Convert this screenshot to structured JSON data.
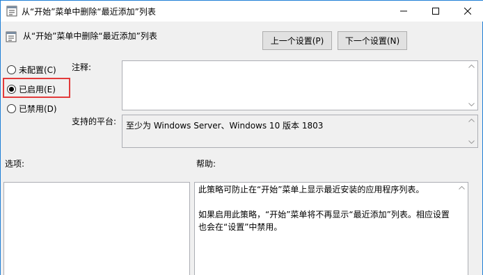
{
  "window": {
    "title": "从“开始”菜单中删除“最近添加”列表"
  },
  "header": {
    "title": "从“开始”菜单中删除“最近添加”列表",
    "prev_button": "上一个设置(P)",
    "next_button": "下一个设置(N)"
  },
  "state": {
    "options": [
      {
        "label": "未配置(C)",
        "checked": false
      },
      {
        "label": "已启用(E)",
        "checked": true
      },
      {
        "label": "已禁用(D)",
        "checked": false
      }
    ]
  },
  "comment": {
    "label": "注释:",
    "value": ""
  },
  "platform": {
    "label": "支持的平台:",
    "value": "至少为 Windows Server、Windows 10 版本 1803"
  },
  "options_section": {
    "label": "选项:"
  },
  "help_section": {
    "label": "帮助:",
    "paragraphs": [
      "此策略可防止在“开始”菜单上显示最近安装的应用程序列表。",
      "如果启用此策略，“开始”菜单将不再显示“最近添加”列表。相应设置也会在“设置”中禁用。"
    ]
  },
  "icons": {
    "app": "policy-setting-icon",
    "header": "policy-setting-icon",
    "minimize": "minimize-icon",
    "maximize": "maximize-icon",
    "close": "close-icon"
  },
  "colors": {
    "window_border": "#1e7fd6",
    "highlight": "#e23a3a",
    "button_bg": "#e1e1e1"
  }
}
